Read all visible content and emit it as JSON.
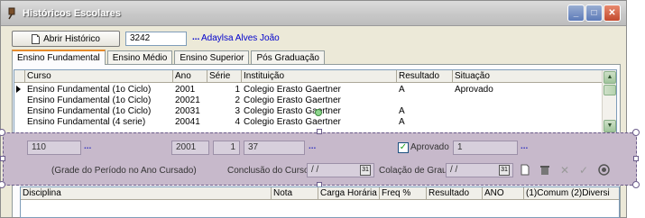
{
  "window": {
    "title": "Históricos Escolares",
    "min": "_",
    "max": "□",
    "close": "✕"
  },
  "toolbar": {
    "open_button": "Abrir Histórico",
    "student_id": "3242",
    "dots": "...",
    "student_name": "Adaylsa Alves João"
  },
  "tabs": [
    {
      "label": "Ensino Fundamental",
      "active": true
    },
    {
      "label": "Ensino Médio",
      "active": false
    },
    {
      "label": "Ensino Superior",
      "active": false
    },
    {
      "label": "Pós Graduação",
      "active": false
    }
  ],
  "grid": {
    "columns": [
      "Curso",
      "Ano",
      "Série",
      "Instituição",
      "Resultado",
      "Situação"
    ],
    "rows": [
      {
        "curso": "Ensino Fundamental (1o Ciclo)",
        "ano": "2001",
        "serie": "1",
        "inst": "Colegio Erasto Gaertner",
        "resultado": "A",
        "situacao": "Aprovado"
      },
      {
        "curso": "Ensino Fundamental (1o Ciclo)",
        "ano": "20021",
        "serie": "2",
        "inst": "Colegio Erasto Gaertner",
        "resultado": "",
        "situacao": ""
      },
      {
        "curso": "Ensino Fundamental (1o Ciclo)",
        "ano": "20031",
        "serie": "3",
        "inst": "Colegio Erasto Gaertner",
        "resultado": "A",
        "situacao": ""
      },
      {
        "curso": "Ensino Fundamental (4 serie)",
        "ano": "20041",
        "serie": "4",
        "inst": "Colegio Erasto Gaertner",
        "resultado": "A",
        "situacao": ""
      }
    ]
  },
  "edit": {
    "curso_code": "110",
    "ano": "2001",
    "serie": "1",
    "inst_code": "37",
    "aprovado_label": "Aprovado",
    "aprovado_checked": "✓",
    "situacao_code": "1",
    "grade_label": "(Grade do Período no Ano Cursado)",
    "conclusao_label": "Conclusão do Curso:",
    "conclusao_value": " / /",
    "colacao_label": "Colação de Grau:",
    "colacao_value": " / /"
  },
  "grid2": {
    "columns": [
      "Disciplina",
      "Nota",
      "Carga Horária",
      "Freq  %",
      "Resultado",
      "ANO",
      "(1)Comum (2)Diversi"
    ]
  },
  "icons": {
    "title": "pin-icon",
    "new": "new-document-icon",
    "delete": "trash-icon",
    "cancel": "cancel-icon",
    "confirm": "check-icon",
    "close": "close-circle-icon"
  }
}
